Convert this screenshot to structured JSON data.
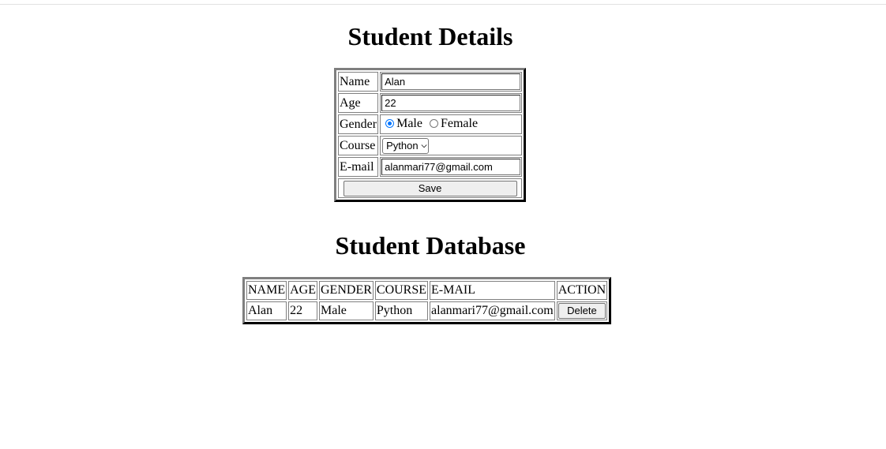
{
  "form": {
    "title": "Student Details",
    "name_label": "Name",
    "name_value": "Alan",
    "age_label": "Age",
    "age_value": "22",
    "gender_label": "Gender",
    "gender_options": [
      "Male",
      "Female"
    ],
    "gender_selected": "Male",
    "course_label": "Course",
    "course_value": "Python",
    "email_label": "E-mail",
    "email_value": "alanmari77@gmail.com",
    "save_label": "Save"
  },
  "database": {
    "title": "Student Database",
    "headers": [
      "NAME",
      "AGE",
      "GENDER",
      "COURSE",
      "E-MAIL",
      "ACTION"
    ],
    "rows": [
      {
        "name": "Alan",
        "age": "22",
        "gender": "Male",
        "course": "Python",
        "email": "alanmari77@gmail.com",
        "action_label": "Delete"
      }
    ]
  },
  "colors": {
    "radio_accent": "#0075ff",
    "button_bg": "#efefef"
  }
}
